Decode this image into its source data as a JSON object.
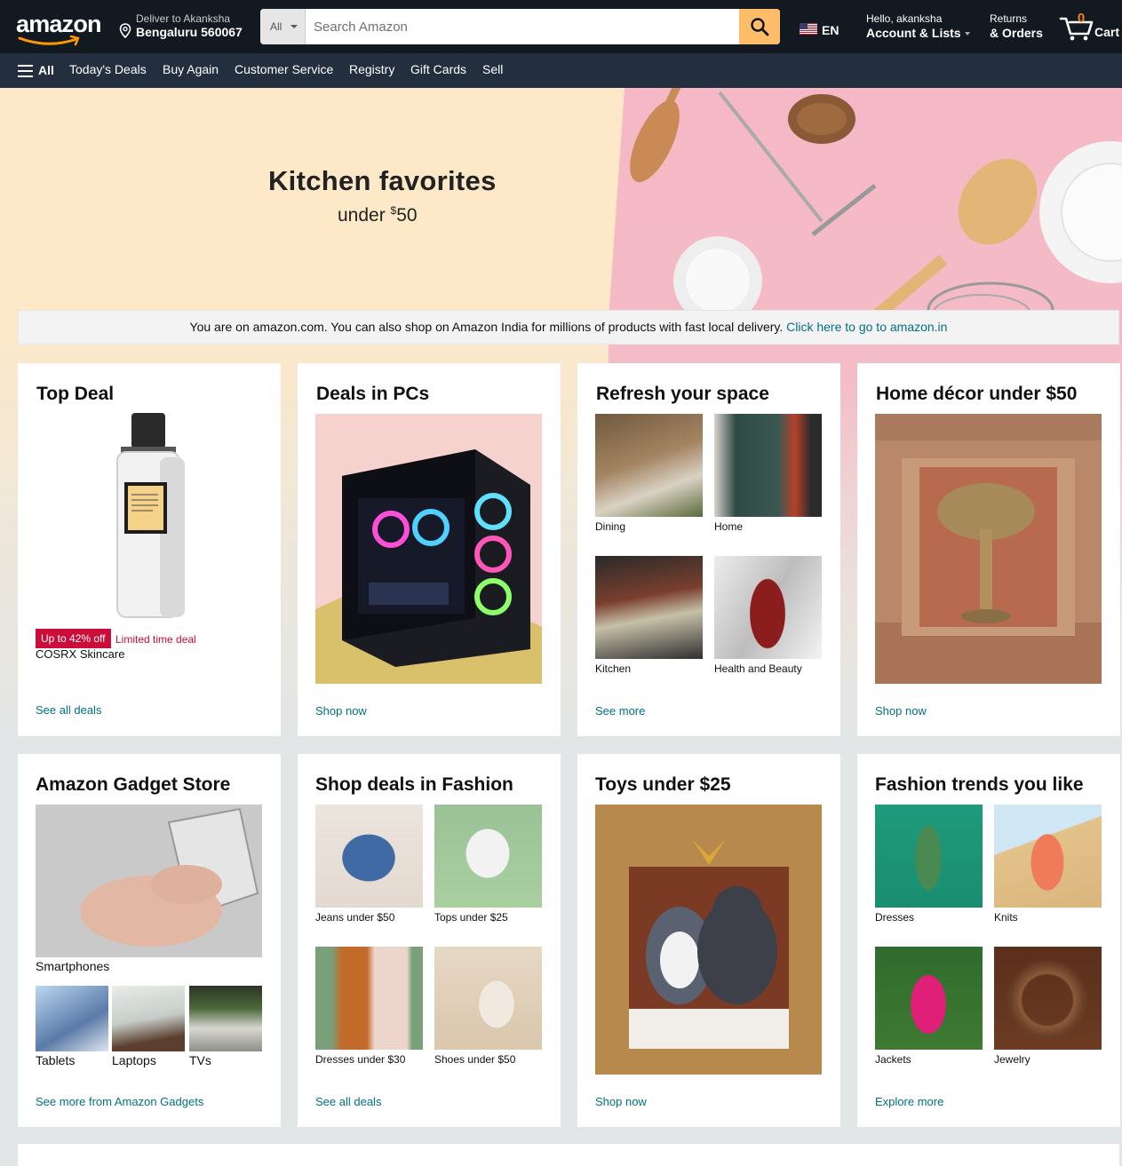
{
  "header": {
    "logo_text": "amazon",
    "deliver_line1": "Deliver to Akanksha",
    "deliver_line2": "Bengaluru 560067",
    "search_category": "All",
    "search_placeholder": "Search Amazon",
    "language": "EN",
    "account_line1": "Hello, akanksha",
    "account_line2": "Account & Lists",
    "returns_line1": "Returns",
    "returns_line2": "& Orders",
    "cart_count": "0",
    "cart_label": "Cart"
  },
  "subnav": {
    "all_label": "All",
    "links": [
      "Today's Deals",
      "Buy Again",
      "Customer Service",
      "Registry",
      "Gift Cards",
      "Sell"
    ]
  },
  "hero": {
    "title": "Kitchen favorites",
    "subtitle_prefix": "under ",
    "subtitle_currency": "$",
    "subtitle_amount": "50"
  },
  "notice": {
    "text": "You are on amazon.com. You can also shop on Amazon India for millions of products with fast local delivery. ",
    "link": "Click here to go to amazon.in"
  },
  "cards": {
    "top_deal": {
      "title": "Top Deal",
      "badge": "Up to 42% off",
      "badge_text": "Limited time deal",
      "product": "COSRX Skincare",
      "cta": "See all deals"
    },
    "pcs": {
      "title": "Deals in PCs",
      "cta": "Shop now"
    },
    "refresh": {
      "title": "Refresh your space",
      "tiles": [
        "Dining",
        "Home",
        "Kitchen",
        "Health and Beauty"
      ],
      "cta": "See more"
    },
    "home_decor": {
      "title": "Home décor under $50",
      "cta": "Shop now"
    },
    "gadget": {
      "title": "Amazon Gadget Store",
      "main_caption": "Smartphones",
      "tiles": [
        "Tablets",
        "Laptops",
        "TVs"
      ],
      "cta": "See more from Amazon Gadgets"
    },
    "fashion_deals": {
      "title": "Shop deals in Fashion",
      "tiles": [
        "Jeans under $50",
        "Tops under $25",
        "Dresses under $30",
        "Shoes under $50"
      ],
      "cta": "See all deals"
    },
    "toys": {
      "title": "Toys under $25",
      "cta": "Shop now"
    },
    "fashion_trends": {
      "title": "Fashion trends you like",
      "tiles": [
        "Dresses",
        "Knits",
        "Jackets",
        "Jewelry"
      ],
      "cta": "Explore more"
    }
  },
  "colors": {
    "nav_dark": "#131921",
    "nav_sub": "#232f3e",
    "search_button": "#febd69",
    "cart_count": "#f08804",
    "link": "#007185",
    "deal_red": "#cc0c39"
  }
}
